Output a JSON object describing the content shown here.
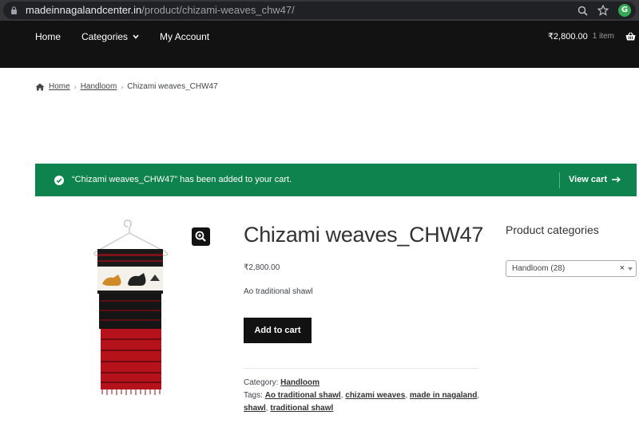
{
  "browser": {
    "url_host": "madeinnagalandcenter.in",
    "url_path": "/product/chizami-weaves_chw47/",
    "profile_initial": "G"
  },
  "header": {
    "nav": {
      "home": "Home",
      "categories": "Categories",
      "account": "My Account"
    },
    "cart_total": "₹2,800.00",
    "cart_count": "1 item"
  },
  "breadcrumb": {
    "home": "Home",
    "category": "Handloom",
    "current": "Chizami weaves_CHW47"
  },
  "notice": {
    "message": "“Chizami weaves_CHW47” has been added to your cart.",
    "view_cart": "View cart"
  },
  "product": {
    "title": "Chizami weaves_CHW47",
    "price": "₹2,800.00",
    "short_description": "Ao traditional shawl",
    "add_to_cart": "Add to cart",
    "category_label": "Category:",
    "category": "Handloom",
    "tags_label": "Tags:",
    "tags": [
      "Ao traditional shawl",
      "chizami weaves",
      "made in nagaland",
      "shawl",
      "traditional shawl"
    ]
  },
  "sidebar": {
    "title": "Product categories",
    "select_value": "Handloom  (28)",
    "clear": "×"
  },
  "colors": {
    "header_bg": "#121212",
    "notice_bg": "#0f834d",
    "button_bg": "#121212",
    "shawl_red": "#b5121b"
  }
}
